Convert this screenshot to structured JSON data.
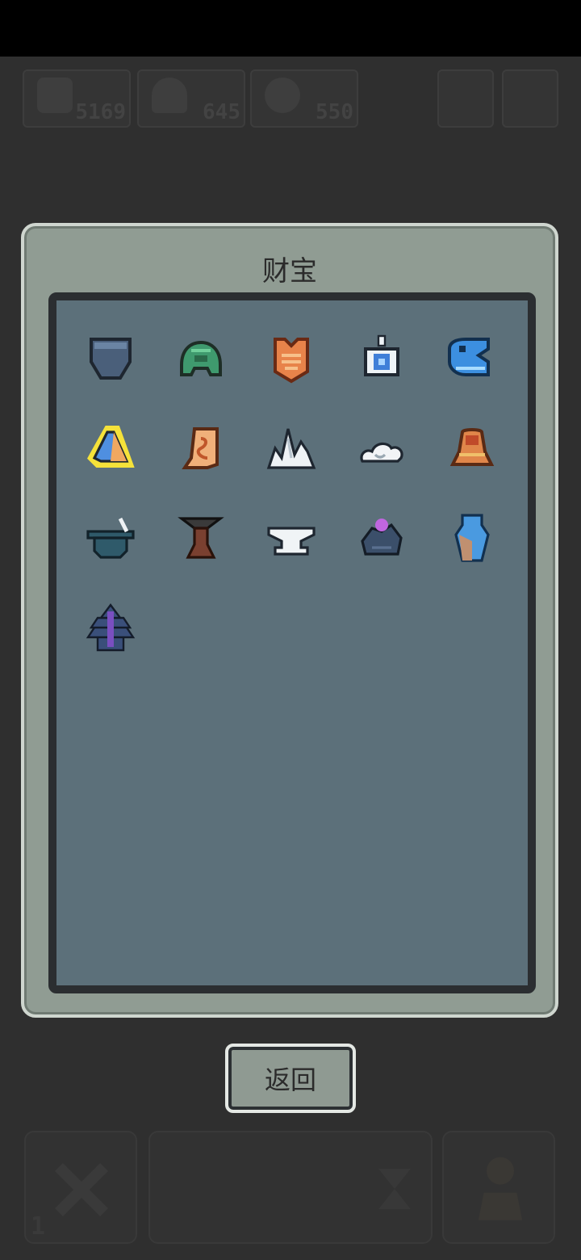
{
  "hud": {
    "resources": [
      {
        "icon": "stone-icon",
        "value": "5169"
      },
      {
        "icon": "worker-icon",
        "value": "645"
      },
      {
        "icon": "bag-icon",
        "value": "550"
      }
    ]
  },
  "dialog": {
    "title": "财宝",
    "treasures": [
      {
        "name": "pocket-treasure-icon",
        "color": "#4a5f7a"
      },
      {
        "name": "green-helmet-treasure-icon",
        "color": "#3f9a6e"
      },
      {
        "name": "orange-armor-treasure-icon",
        "color": "#e8834a"
      },
      {
        "name": "blue-gem-amulet-treasure-icon",
        "color": "#3f7fd8"
      },
      {
        "name": "blue-whale-treasure-icon",
        "color": "#3c8fe0"
      },
      {
        "name": "blue-crystal-treasure-icon",
        "color": "#4f8fe0",
        "selected": true
      },
      {
        "name": "scroll-treasure-icon",
        "color": "#f0b07a"
      },
      {
        "name": "white-crystals-treasure-icon",
        "color": "#eef2f5"
      },
      {
        "name": "cloud-treasure-icon",
        "color": "#f2f4f6"
      },
      {
        "name": "bell-treasure-icon",
        "color": "#e0864a"
      },
      {
        "name": "cauldron-treasure-icon",
        "color": "#2f5a6a"
      },
      {
        "name": "anvil-stump-treasure-icon",
        "color": "#7a4030"
      },
      {
        "name": "anvil-treasure-icon",
        "color": "#f0f4f6"
      },
      {
        "name": "ore-flower-treasure-icon",
        "color": "#3b4f6a"
      },
      {
        "name": "blue-shell-treasure-icon",
        "color": "#4a9ae0"
      },
      {
        "name": "pagoda-treasure-icon",
        "color": "#3a4f7a"
      }
    ]
  },
  "back_button": {
    "label": "返回"
  },
  "bottom_bar": {
    "slot_count": "1"
  },
  "colors": {
    "panel": "#909c93",
    "grid_bg": "#5c707a",
    "frame": "#2b2e31",
    "selection": "#f5e23a"
  }
}
